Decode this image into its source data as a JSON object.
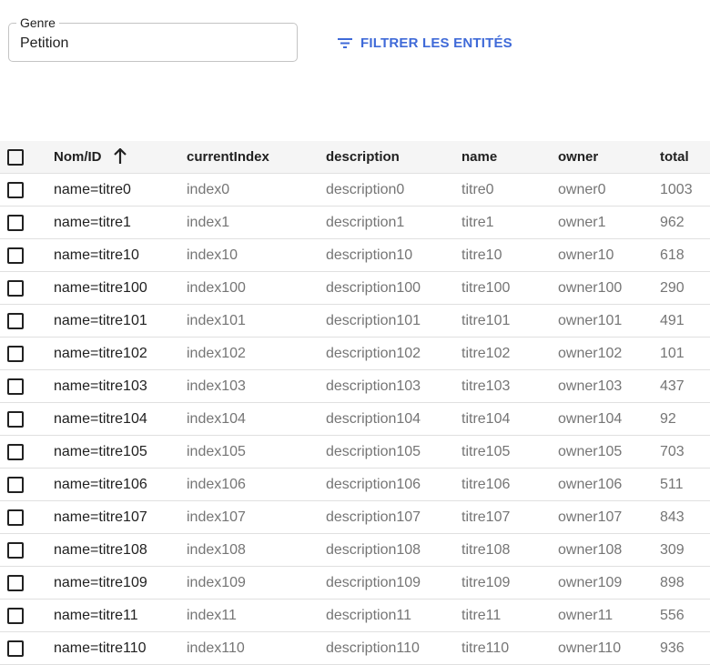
{
  "filter": {
    "genre_label": "Genre",
    "genre_value": "Petition",
    "filter_button_label": "FILTRER LES ENTITÉS"
  },
  "table": {
    "headers": {
      "name_id": "Nom/ID",
      "current_index": "currentIndex",
      "description": "description",
      "name": "name",
      "owner": "owner",
      "total": "total"
    },
    "sort": {
      "column": "Nom/ID",
      "direction": "ascending"
    },
    "rows": [
      {
        "id": "name=titre0",
        "currentIndex": "index0",
        "description": "description0",
        "name": "titre0",
        "owner": "owner0",
        "total": "1003"
      },
      {
        "id": "name=titre1",
        "currentIndex": "index1",
        "description": "description1",
        "name": "titre1",
        "owner": "owner1",
        "total": "962"
      },
      {
        "id": "name=titre10",
        "currentIndex": "index10",
        "description": "description10",
        "name": "titre10",
        "owner": "owner10",
        "total": "618"
      },
      {
        "id": "name=titre100",
        "currentIndex": "index100",
        "description": "description100",
        "name": "titre100",
        "owner": "owner100",
        "total": "290"
      },
      {
        "id": "name=titre101",
        "currentIndex": "index101",
        "description": "description101",
        "name": "titre101",
        "owner": "owner101",
        "total": "491"
      },
      {
        "id": "name=titre102",
        "currentIndex": "index102",
        "description": "description102",
        "name": "titre102",
        "owner": "owner102",
        "total": "101"
      },
      {
        "id": "name=titre103",
        "currentIndex": "index103",
        "description": "description103",
        "name": "titre103",
        "owner": "owner103",
        "total": "437"
      },
      {
        "id": "name=titre104",
        "currentIndex": "index104",
        "description": "description104",
        "name": "titre104",
        "owner": "owner104",
        "total": "92"
      },
      {
        "id": "name=titre105",
        "currentIndex": "index105",
        "description": "description105",
        "name": "titre105",
        "owner": "owner105",
        "total": "703"
      },
      {
        "id": "name=titre106",
        "currentIndex": "index106",
        "description": "description106",
        "name": "titre106",
        "owner": "owner106",
        "total": "511"
      },
      {
        "id": "name=titre107",
        "currentIndex": "index107",
        "description": "description107",
        "name": "titre107",
        "owner": "owner107",
        "total": "843"
      },
      {
        "id": "name=titre108",
        "currentIndex": "index108",
        "description": "description108",
        "name": "titre108",
        "owner": "owner108",
        "total": "309"
      },
      {
        "id": "name=titre109",
        "currentIndex": "index109",
        "description": "description109",
        "name": "titre109",
        "owner": "owner109",
        "total": "898"
      },
      {
        "id": "name=titre11",
        "currentIndex": "index11",
        "description": "description11",
        "name": "titre11",
        "owner": "owner11",
        "total": "556"
      },
      {
        "id": "name=titre110",
        "currentIndex": "index110",
        "description": "description110",
        "name": "titre110",
        "owner": "owner110",
        "total": "936"
      }
    ]
  },
  "colors": {
    "accent": "#3f6ad8",
    "header_bg": "#f5f5f5",
    "muted_text": "#757575",
    "divider": "#e0e0e0"
  },
  "icons": {
    "filter": "filter-list-icon",
    "sort": "arrow-up-icon",
    "checkbox": "checkbox-outline-icon"
  }
}
